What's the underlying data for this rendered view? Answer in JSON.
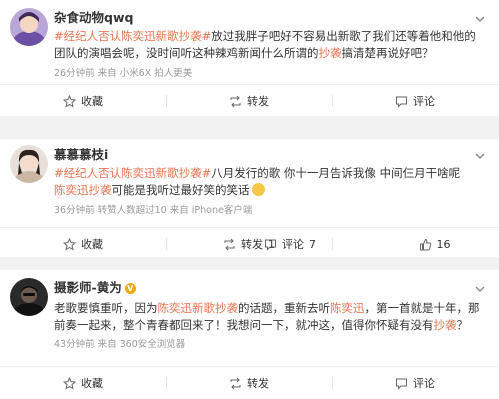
{
  "posts": [
    {
      "username": "杂食动物qwq",
      "content_tag": "#经纪人否认陈奕迅新歌抄袭#",
      "content_text": "放过我胖子吧好不容易出新歌了我们还等着他和他的团队的演唱会呢，没时间听这种辣鸡新闻什么所谓的",
      "content_link2": "抄袭",
      "content_tail": "搞清楚再说好吧？",
      "meta": "26分钟前 来自 小米6X 拍人更美",
      "actions": {
        "collect": "收藏",
        "repost": "转发",
        "comment": "评论",
        "like_count": ""
      }
    },
    {
      "username": "慕慕慕枝i",
      "content_tag": "#经纪人否认陈奕迅新歌抄袭#",
      "content_text": "八月发行的歌 你十一月告诉我像 中间仨月干啥呢",
      "content_link2": "陈奕迅抄袭",
      "content_tail": "可能是我听过最好笑的笑话",
      "meta": "36分钟前 转赞人数超过10 来自 iPhone客户端",
      "actions": {
        "collect": "收藏",
        "repost": "转发",
        "repost_count": "1",
        "comment": "评论",
        "comment_count": "7",
        "like_count": "16"
      }
    },
    {
      "username": "摄影师-黄为",
      "content_a": "老歌要慎重听，因为",
      "content_l1": "陈奕迅新歌抄袭",
      "content_b": "的话题，重新去听",
      "content_l2": "陈奕迅",
      "content_c": "，第一首就是十年，那前奏一起来，整个青春都回来了！我想问一下，就冲这，值得你怀疑有没有",
      "content_l3": "抄袭",
      "content_d": "？",
      "meta": "43分钟前 来自 360安全浏览器",
      "actions": {
        "collect": "收藏",
        "repost": "转发",
        "comment": "评论",
        "like_count": ""
      }
    }
  ],
  "colors": {
    "link": "#eb7350",
    "meta": "#999999",
    "background": "#f2f2f2"
  }
}
